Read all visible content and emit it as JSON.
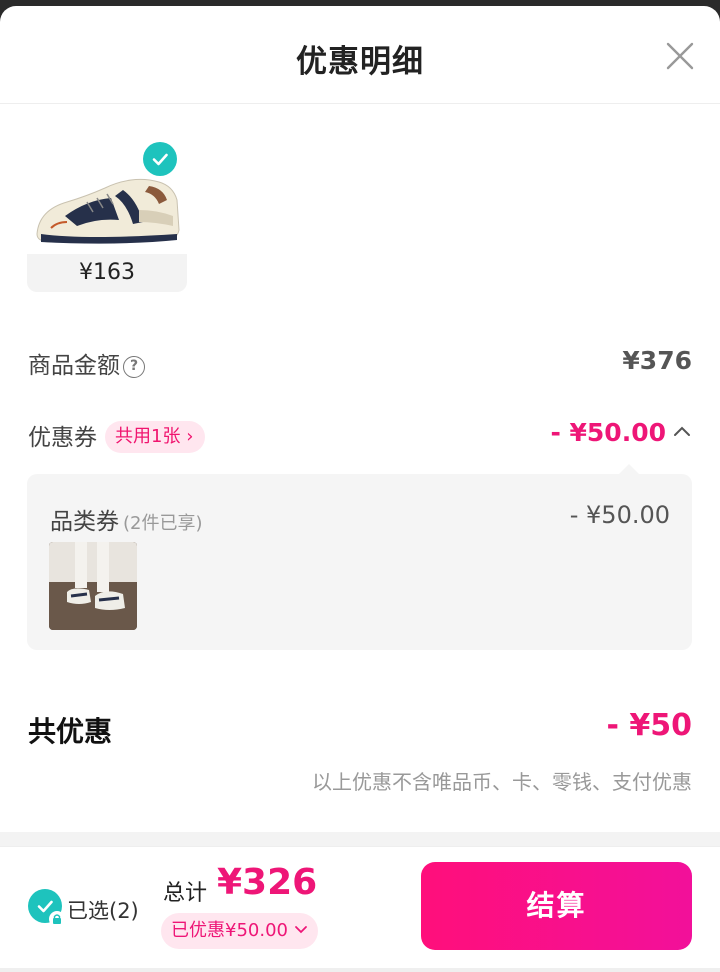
{
  "header": {
    "title": "优惠明细"
  },
  "product": {
    "price": "¥163"
  },
  "rows": {
    "goods_amount": {
      "label": "商品金额",
      "value": "¥376"
    },
    "coupon": {
      "label": "优惠券",
      "tag": "共用1张",
      "value": "- ¥50.00"
    }
  },
  "coupon_detail": {
    "title": "品类券",
    "subtitle": "(2件已享)",
    "amount": "- ¥50.00"
  },
  "total": {
    "label": "共优惠",
    "value": "- ¥50",
    "disclaimer": "以上优惠不含唯品币、卡、零钱、支付优惠"
  },
  "footer": {
    "selected_label": "已选(2)",
    "sum_label": "总计",
    "sum_value": "¥326",
    "saved_label": "已优惠¥50.00",
    "checkout_label": "结算"
  },
  "colors": {
    "accent": "#ee1677",
    "check": "#1ec3bd",
    "pill_bg": "#ffe6ef"
  }
}
